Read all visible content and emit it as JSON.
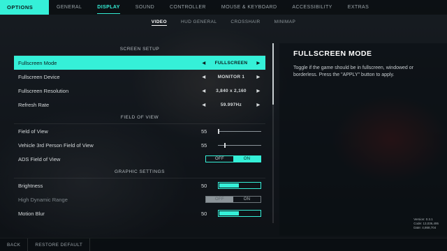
{
  "top_nav": {
    "options_label": "OPTIONS",
    "tabs": [
      {
        "label": "GENERAL"
      },
      {
        "label": "DISPLAY"
      },
      {
        "label": "SOUND"
      },
      {
        "label": "CONTROLLER"
      },
      {
        "label": "MOUSE & KEYBOARD"
      },
      {
        "label": "ACCESSIBILITY"
      },
      {
        "label": "EXTRAS"
      }
    ],
    "active_tab": "DISPLAY"
  },
  "sub_nav": {
    "tabs": [
      {
        "label": "VIDEO"
      },
      {
        "label": "HUD GENERAL"
      },
      {
        "label": "CROSSHAIR"
      },
      {
        "label": "MINIMAP"
      }
    ],
    "active_tab": "VIDEO"
  },
  "sections": {
    "screen_setup": {
      "header": "SCREEN SETUP",
      "fullscreen_mode": {
        "label": "Fullscreen Mode",
        "value": "FULLSCREEN"
      },
      "fullscreen_device": {
        "label": "Fullscreen Device",
        "value": "MONITOR 1"
      },
      "fullscreen_resolution": {
        "label": "Fullscreen Resolution",
        "value": "3,840 x 2,160"
      },
      "refresh_rate": {
        "label": "Refresh Rate",
        "value": "59.997Hz"
      }
    },
    "field_of_view": {
      "header": "FIELD OF VIEW",
      "fov": {
        "label": "Field of View",
        "value": "55",
        "level": 0.0
      },
      "vehicle_fov": {
        "label": "Vehicle 3rd Person Field of View",
        "value": "55",
        "level": 0.14
      },
      "ads_fov": {
        "label": "ADS Field of View",
        "off": "OFF",
        "on": "ON",
        "state": "on"
      }
    },
    "graphic_settings": {
      "header": "GRAPHIC SETTINGS",
      "brightness": {
        "label": "Brightness",
        "value": "50",
        "level": 0.5
      },
      "hdr": {
        "label": "High Dynamic Range",
        "off": "OFF",
        "on": "ON",
        "state": "off",
        "disabled": true
      },
      "motion_blur": {
        "label": "Motion Blur",
        "value": "50",
        "level": 0.5
      }
    }
  },
  "description": {
    "title": "FULLSCREEN MODE",
    "text": "Toggle if the game should be in fullscreen, windowed or borderless. Press the \"APPLY\" button to apply."
  },
  "version_info": {
    "version": "Version: 0.3.1",
    "code": "Code: 13,036,495",
    "date": "Date: 4,868,704"
  },
  "bottom_bar": {
    "back_label": "BACK",
    "restore_label": "RESTORE DEFAULT"
  },
  "colors": {
    "accent": "#35f0d8",
    "text": "#d6dadc",
    "background": "#0c1014"
  },
  "icons": {
    "left_arrow": "left-arrow-icon",
    "right_arrow": "right-arrow-icon"
  }
}
